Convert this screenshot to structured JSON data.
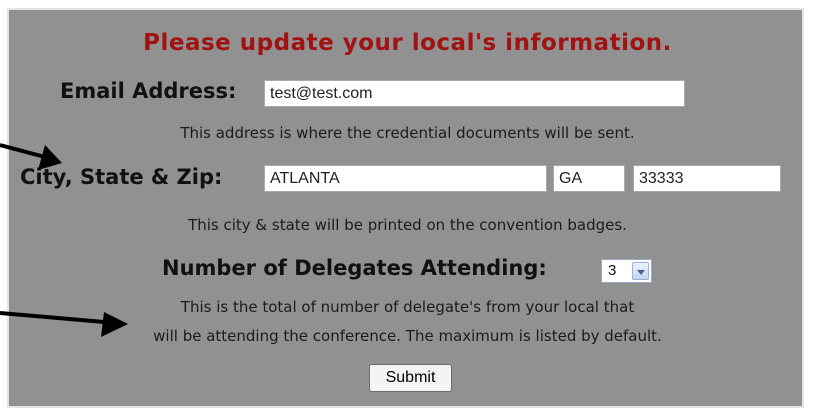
{
  "form": {
    "title": "Please update your local's information.",
    "email": {
      "label": "Email Address:",
      "value": "test@test.com",
      "note": "This address is where the credential documents will be sent."
    },
    "location": {
      "label": "City, State & Zip:",
      "city": "ATLANTA",
      "state": "GA",
      "zip": "33333",
      "note": "This city & state will be printed on the convention badges."
    },
    "delegates": {
      "label": "Number of Delegates Attending:",
      "selected": "3",
      "note_line1": "This is the total of number of delegate's from your local that",
      "note_line2": "will be attending the conference. The maximum is listed by default."
    },
    "submit_label": "Submit"
  },
  "annotation_color": "#000000"
}
